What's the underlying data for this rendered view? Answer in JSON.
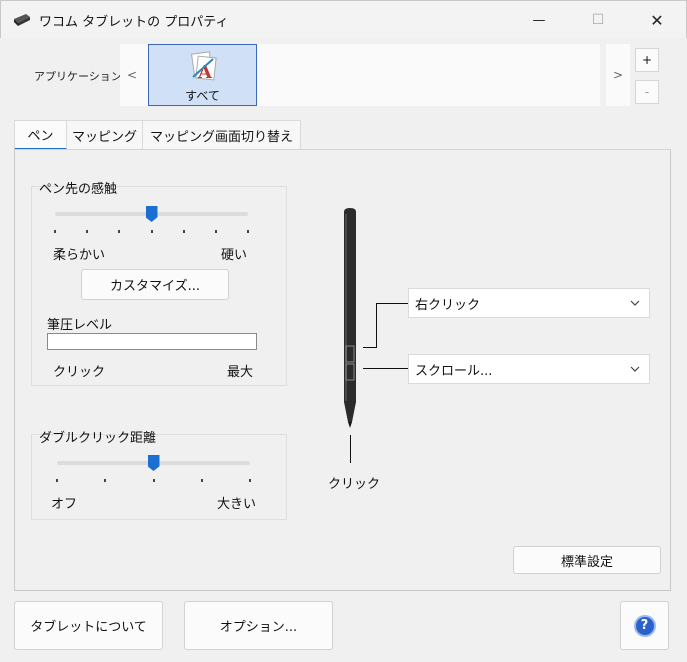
{
  "window": {
    "title": "ワコム タブレットの プロパティ",
    "controls": {
      "minimize": "—",
      "maximize": "☐",
      "close": "✕"
    }
  },
  "application_bar": {
    "label": "アプリケーション:",
    "nav_prev": "<",
    "nav_next": ">",
    "selected_tile": "すべて",
    "add": "+",
    "remove": "-"
  },
  "tabs": [
    {
      "label": "ペン",
      "active": true
    },
    {
      "label": "マッピング",
      "active": false
    },
    {
      "label": "マッピング画面切り替え",
      "active": false
    }
  ],
  "pen_feel": {
    "title": "ペン先の感触",
    "min_label": "柔らかい",
    "max_label": "硬い",
    "slider_position_fraction": 0.5,
    "customize_button": "カスタマイズ...",
    "pressure_label": "筆圧レベル",
    "pressure_level_fraction": 0.0,
    "pressure_min_label": "クリック",
    "pressure_max_label": "最大"
  },
  "double_click": {
    "title": "ダブルクリック距離",
    "min_label": "オフ",
    "max_label": "大きい",
    "slider_position_fraction": 0.5
  },
  "pen_buttons": {
    "upper_button": "右クリック",
    "lower_button": "スクロール...",
    "tip": "クリック"
  },
  "default_button": "標準設定",
  "footer": {
    "about_button": "タブレットについて",
    "options_button": "オプション...",
    "help_icon": "?"
  },
  "colors": {
    "accent": "#1a6fd1",
    "tile_selected": "#cfe0f7",
    "help_icon": "#2a62c9"
  }
}
